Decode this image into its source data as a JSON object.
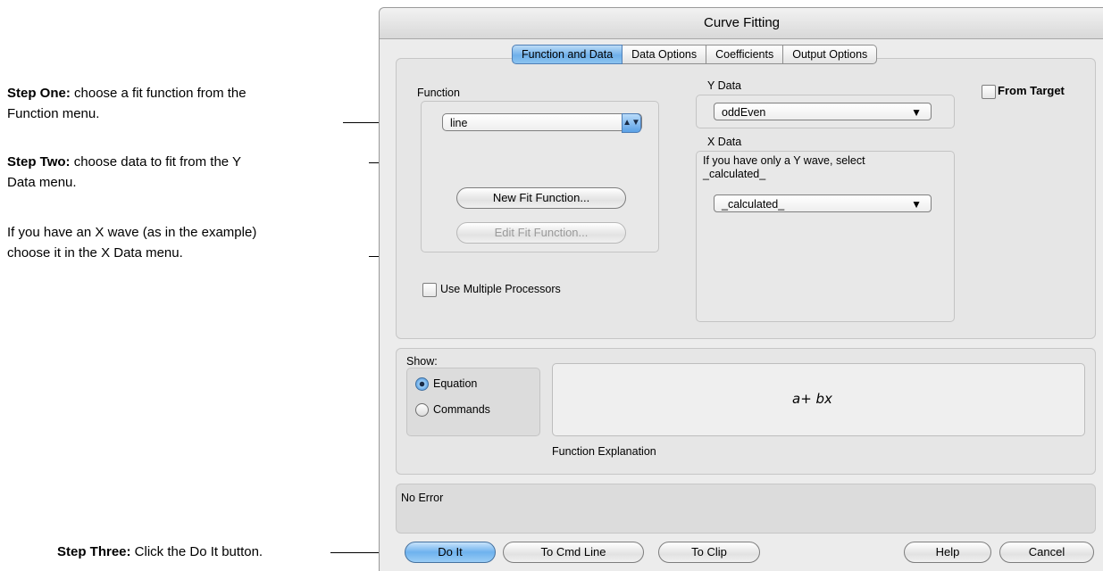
{
  "annotations": {
    "step_one_bold": "Step One:",
    "step_one_line1": " choose a fit function from the",
    "step_one_line2": "Function menu.",
    "step_two_bold": "Step Two:",
    "step_two_line1": " choose data to fit from the Y",
    "step_two_line2": "Data menu.",
    "x_wave_line1": "If you have an X wave (as in the example)",
    "x_wave_line2": "choose it in the X Data menu.",
    "step_three_bold": "Step Three:",
    "step_three_text": " Click the Do It button."
  },
  "window": {
    "title": "Curve Fitting"
  },
  "tabs": [
    {
      "label": "Function and Data",
      "active": true
    },
    {
      "label": "Data Options",
      "active": false
    },
    {
      "label": "Coefficients",
      "active": false
    },
    {
      "label": "Output Options",
      "active": false
    }
  ],
  "function_group": {
    "title": "Function",
    "selected": "line",
    "new_fit_button": "New Fit Function...",
    "edit_fit_button": "Edit Fit Function..."
  },
  "y_data": {
    "title": "Y Data",
    "selected": "oddEven"
  },
  "x_data": {
    "title": "X Data",
    "hint_line1": "If you have only a Y wave, select",
    "hint_line2": "_calculated_",
    "selected": "_calculated_"
  },
  "from_target": {
    "label": "From Target",
    "checked": false
  },
  "multiprocessors": {
    "label": "Use Multiple Processors",
    "checked": false
  },
  "show": {
    "title": "Show:",
    "options": [
      "Equation",
      "Commands"
    ],
    "selected": "Equation"
  },
  "explanation": {
    "equation": "a+ bx",
    "caption": "Function Explanation"
  },
  "error": {
    "text": "No Error"
  },
  "buttons": {
    "do_it": "Do It",
    "to_cmd_line": "To Cmd Line",
    "to_clip": "To Clip",
    "help": "Help",
    "cancel": "Cancel"
  },
  "colors": {
    "accent_blue": "#6fb0ea",
    "window_bg": "#ececec"
  }
}
